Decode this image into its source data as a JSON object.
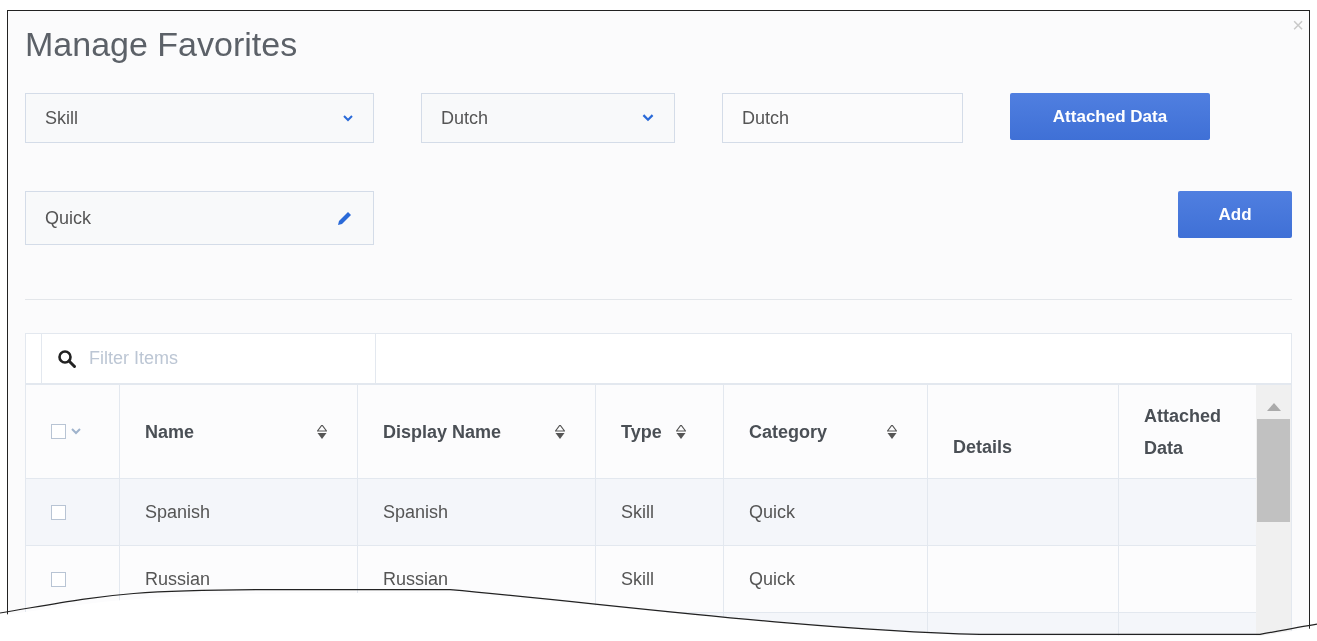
{
  "dialog": {
    "title": "Manage Favorites",
    "close": "×"
  },
  "form": {
    "type_select": {
      "value": "Skill"
    },
    "item_select": {
      "value": "Dutch"
    },
    "display_name": {
      "value": "Dutch"
    },
    "attached_data_button": "Attached Data",
    "category_field": {
      "value": "Quick"
    },
    "add_button": "Add"
  },
  "filter": {
    "placeholder": "Filter Items"
  },
  "table": {
    "select_all": {
      "checked": false
    },
    "columns": [
      {
        "label": "Name",
        "sortable": true
      },
      {
        "label": "Display Name",
        "sortable": true
      },
      {
        "label": "Type",
        "sortable": true
      },
      {
        "label": "Category",
        "sortable": true
      },
      {
        "label": "Details",
        "sortable": false
      },
      {
        "label": "Attached Data",
        "sortable": false
      }
    ],
    "rows": [
      {
        "checked": false,
        "cells": [
          "Spanish",
          "Spanish",
          "Skill",
          "Quick",
          "",
          ""
        ]
      },
      {
        "checked": false,
        "cells": [
          "Russian",
          "Russian",
          "Skill",
          "Quick",
          "",
          ""
        ]
      }
    ]
  }
}
